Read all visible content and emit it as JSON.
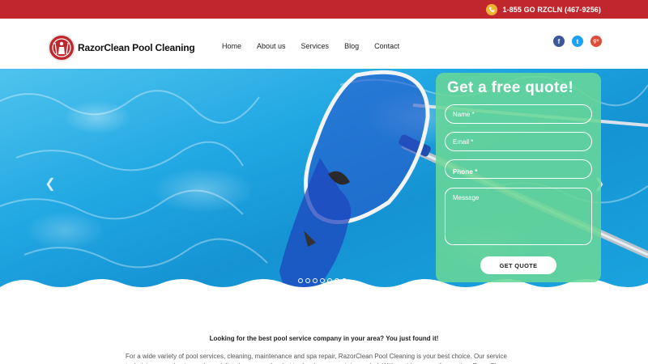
{
  "topbar": {
    "phone": "1-855 GO RZCLN (467-9256)",
    "phone_icon": "phone-icon",
    "background": "#c0272d"
  },
  "header": {
    "logo_text": "RazorClean Pool Cleaning",
    "nav": [
      "Home",
      "About us",
      "Services",
      "Blog",
      "Contact"
    ],
    "socials": [
      {
        "name": "facebook-icon",
        "glyph": "f",
        "color": "#3b5998"
      },
      {
        "name": "twitter-icon",
        "glyph": "t",
        "color": "#1da1f2"
      },
      {
        "name": "google-plus-icon",
        "glyph": "g+",
        "color": "#dd4b39"
      }
    ]
  },
  "hero": {
    "slides_total": 7,
    "active_slide": 7
  },
  "quote_form": {
    "title": "Get a free quote!",
    "name_placeholder": "Name *",
    "email_placeholder": "Email *",
    "phone_placeholder": "Phone *",
    "message_placeholder": "Message",
    "button": "GET QUOTE",
    "background": "#69d796"
  },
  "content": {
    "headline": "Looking for the best pool service company in your area? You just found it!",
    "paragraph": "For a wide variety of pool services, cleaning, maintenance and spa repair, RazorClean Pool Cleaning is your best choice. Our service technicians, mechanics and specialists know exactly what to do when a repair is needed. With a wide range of expertise, RazorClean"
  }
}
